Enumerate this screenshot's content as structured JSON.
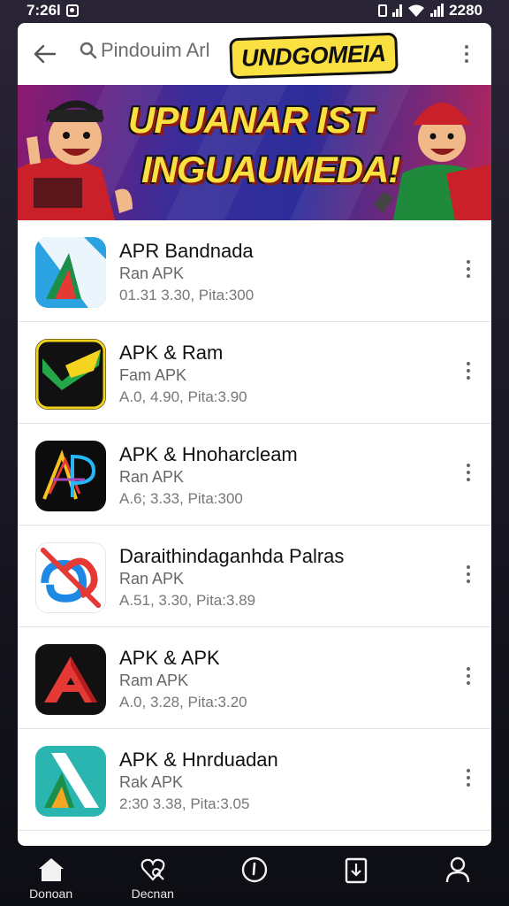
{
  "status_bar": {
    "time": "7:26l",
    "clock_right": "2280"
  },
  "header": {
    "search_text": "Pindouim Arl",
    "promo_title": "UNDGOMEIA"
  },
  "banner": {
    "line1": "UPUANAR IST",
    "line2": "INGUAUMEDA!"
  },
  "apps": [
    {
      "name": "APR Bandnada",
      "sub": "Ran APK",
      "meta": "01.31 3.30, Pita:300",
      "icon": "triangle-a-blue-icon",
      "bg": "#2aa3e0"
    },
    {
      "name": "APK & Ram",
      "sub": "Fam APK",
      "meta": "A.0, 4.90, Pita:3.90",
      "icon": "yellow-check-icon",
      "bg": "#111111"
    },
    {
      "name": "APK & Hnoharcleam",
      "sub": "Ran APK",
      "meta": "A.6; 3.33, Pita:300",
      "icon": "neon-ap-icon",
      "bg": "#0c0c0c"
    },
    {
      "name": "Daraithindaganhda Palras",
      "sub": "Ran APK",
      "meta": "A.51, 3.30, Pita:3.89",
      "icon": "crossed-logo-icon",
      "bg": "#ffffff"
    },
    {
      "name": "APK & APK",
      "sub": "Ram APK",
      "meta": "A.0, 3.28, Pita:3.20",
      "icon": "red-a-icon",
      "bg": "#111111"
    },
    {
      "name": "APK & Hnrduadan",
      "sub": "Rak APK",
      "meta": "2:30 3.38, Pita:3.05",
      "icon": "teal-a-icon",
      "bg": "#2ab5b0"
    }
  ],
  "bottom_nav": [
    {
      "label": "Donoan",
      "icon": "home-icon"
    },
    {
      "label": "Decnan",
      "icon": "heart-search-icon"
    },
    {
      "label": "",
      "icon": "info-circle-icon"
    },
    {
      "label": "",
      "icon": "download-clipboard-icon"
    },
    {
      "label": "",
      "icon": "profile-icon"
    }
  ]
}
